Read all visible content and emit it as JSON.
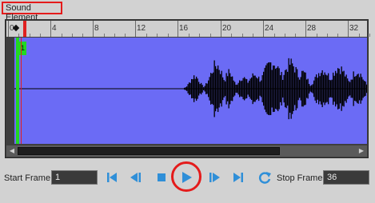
{
  "panel": {
    "title": "Sound Element"
  },
  "ruler": {
    "labels": [
      "0",
      "4",
      "8",
      "12",
      "16",
      "20",
      "24",
      "28",
      "32"
    ]
  },
  "waveform": {
    "frame_tag": "1"
  },
  "controls": {
    "start_frame_label": "Start Frame",
    "start_frame_value": "1",
    "stop_frame_label": "Stop Frame",
    "stop_frame_value": "36"
  },
  "colors": {
    "waveform_bg": "#6b6bf5",
    "accent": "#2f8fd8",
    "highlight": "#e41b1b",
    "frame_marker": "#22d822"
  },
  "icons": [
    "first-frame-icon",
    "previous-frame-icon",
    "stop-icon",
    "play-icon",
    "next-frame-icon",
    "last-frame-icon",
    "loop-icon"
  ]
}
